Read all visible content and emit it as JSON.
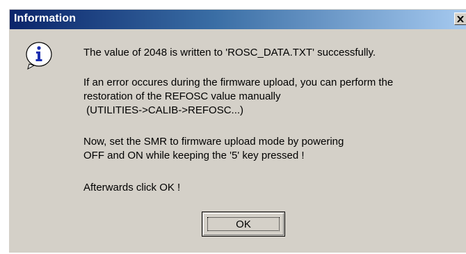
{
  "dialog": {
    "title": "Information",
    "close_glyph": "✕",
    "icon": "info-icon",
    "messages": {
      "line1": "The value of 2048 is written to 'ROSC_DATA.TXT' successfully.",
      "line2": "If an error occures during the firmware upload, you can perform the",
      "line3": "restoration of the REFOSC value manually",
      "line4": " (UTILITIES->CALIB->REFOSC...)",
      "line5": "Now, set the SMR to firmware upload mode by powering",
      "line6": "OFF and ON while keeping the '5' key pressed !",
      "line7": "Afterwards click OK !"
    },
    "ok_label": "OK"
  },
  "colors": {
    "title_bar_start": "#0a246a",
    "title_bar_end": "#a6caf0",
    "dialog_face": "#d4d0c8"
  }
}
